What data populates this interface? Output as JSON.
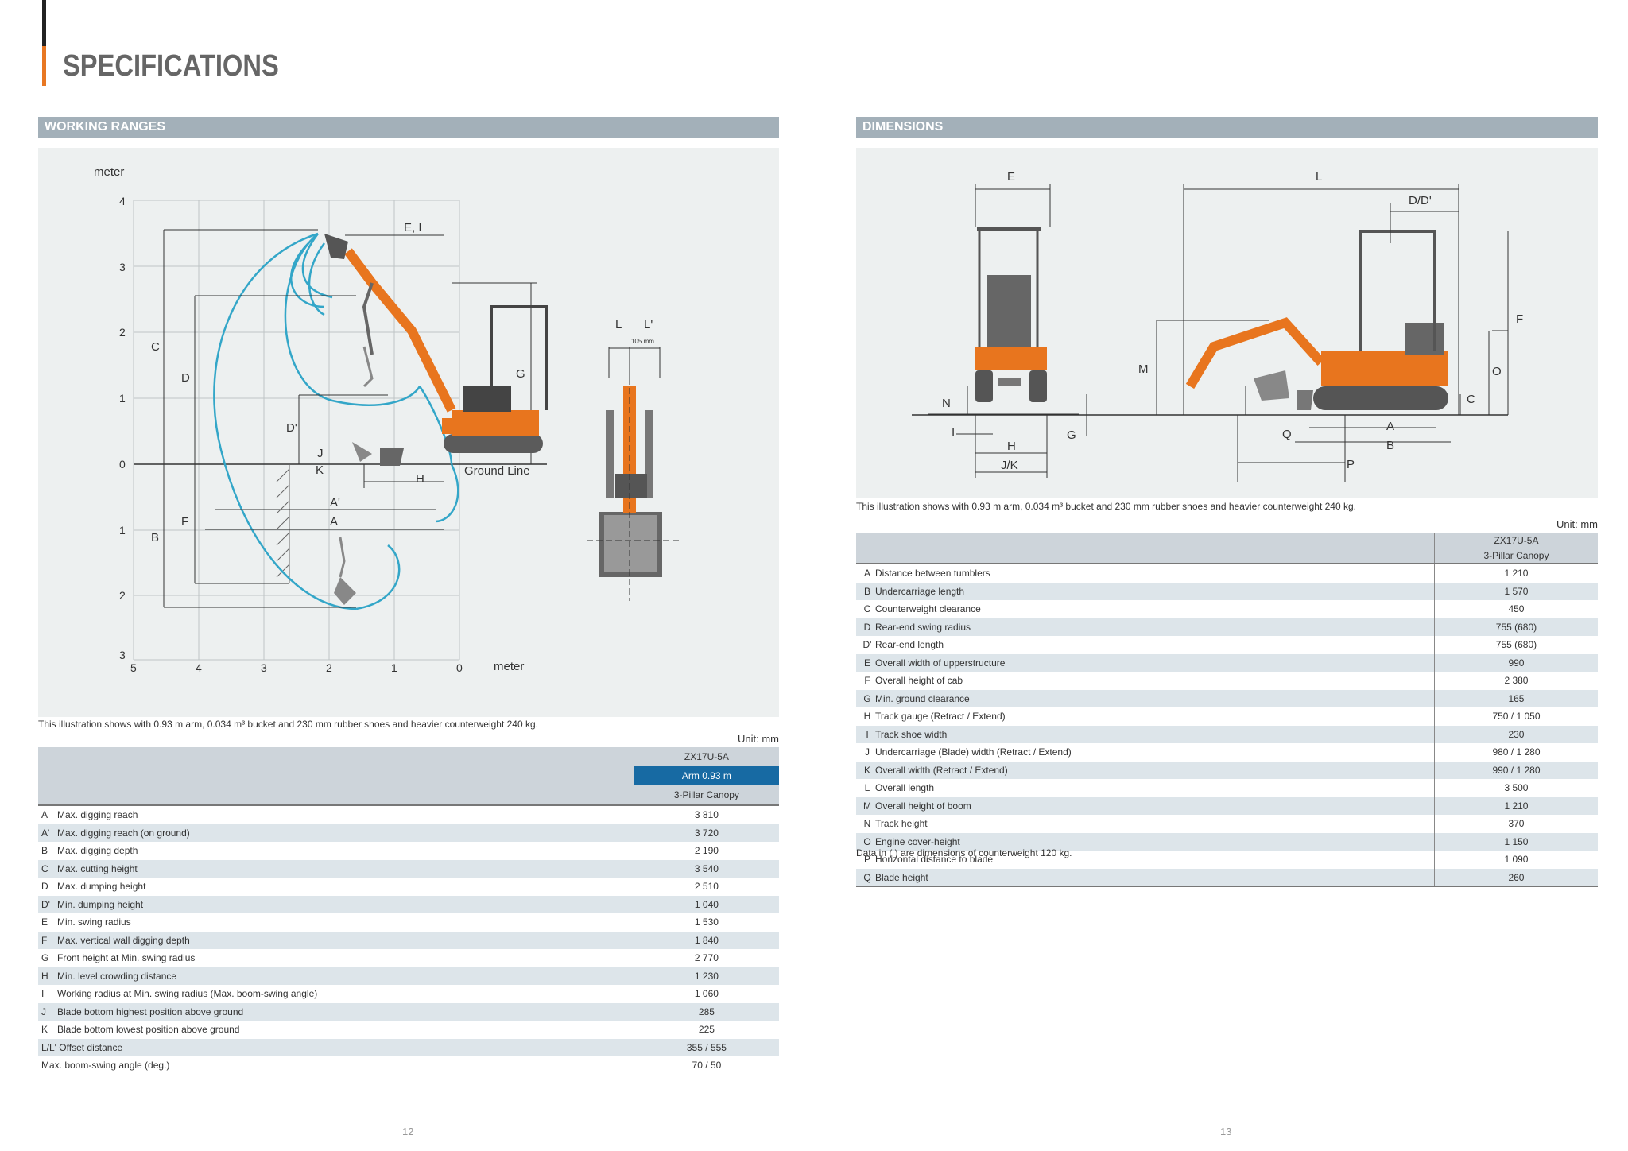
{
  "page_title": "SPECIFICATIONS",
  "left": {
    "section_title": "WORKING RANGES",
    "diagram": {
      "y_unit": "meter",
      "x_unit": "meter",
      "y_ticks_up": [
        "4",
        "3",
        "2",
        "1",
        "0"
      ],
      "y_ticks_down": [
        "1",
        "2",
        "3"
      ],
      "x_ticks": [
        "5",
        "4",
        "3",
        "2",
        "1",
        "0"
      ],
      "labels": [
        "E, I",
        "C",
        "D",
        "G",
        "D'",
        "J",
        "K",
        "H",
        "Ground Line",
        "A'",
        "A",
        "F",
        "B"
      ],
      "offset_labels": [
        "L",
        "L'",
        "105 mm"
      ]
    },
    "note": "This illustration shows with 0.93 m arm, 0.034 m³ bucket and 230 mm rubber shoes and heavier counterweight 240 kg.",
    "unit": "Unit: mm",
    "table": {
      "model": "ZX17U-5A",
      "arm": "Arm 0.93 m",
      "canopy": "3-Pillar Canopy",
      "rows": [
        {
          "letter": "A",
          "label": "Max. digging reach",
          "value": "3 810"
        },
        {
          "letter": "A'",
          "label": "Max. digging reach (on ground)",
          "value": "3 720"
        },
        {
          "letter": "B",
          "label": "Max. digging depth",
          "value": "2 190"
        },
        {
          "letter": "C",
          "label": "Max. cutting height",
          "value": "3 540"
        },
        {
          "letter": "D",
          "label": "Max. dumping height",
          "value": "2 510"
        },
        {
          "letter": "D'",
          "label": "Min. dumping height",
          "value": "1 040"
        },
        {
          "letter": "E",
          "label": "Min. swing radius",
          "value": "1 530"
        },
        {
          "letter": "F",
          "label": "Max. vertical wall digging depth",
          "value": "1 840"
        },
        {
          "letter": "G",
          "label": "Front height at Min. swing radius",
          "value": "2 770"
        },
        {
          "letter": "H",
          "label": "Min. level crowding distance",
          "value": "1 230"
        },
        {
          "letter": "I",
          "label": "Working radius at Min. swing radius (Max. boom-swing angle)",
          "value": "1 060"
        },
        {
          "letter": "J",
          "label": "Blade bottom highest position above ground",
          "value": "285"
        },
        {
          "letter": "K",
          "label": "Blade bottom lowest position above ground",
          "value": "225"
        },
        {
          "letter": "",
          "label": "L/L' Offset distance",
          "value": "355 / 555"
        },
        {
          "letter": "",
          "label": "Max. boom-swing angle (deg.)",
          "value": "70 / 50"
        }
      ]
    },
    "page_number": "12"
  },
  "right": {
    "section_title": "DIMENSIONS",
    "diagram": {
      "labels": [
        "E",
        "N",
        "I",
        "G",
        "H",
        "J/K",
        "L",
        "D/D'",
        "F",
        "M",
        "O",
        "C",
        "Q",
        "A",
        "B",
        "P"
      ]
    },
    "note": "This illustration shows with 0.93 m arm, 0.034 m³ bucket and 230 mm rubber shoes and heavier counterweight 240 kg.",
    "unit": "Unit: mm",
    "table": {
      "model": "ZX17U-5A",
      "canopy": "3-Pillar Canopy",
      "rows": [
        {
          "letter": "A",
          "label": "Distance between tumblers",
          "value": "1 210"
        },
        {
          "letter": "B",
          "label": "Undercarriage length",
          "value": "1 570"
        },
        {
          "letter": "C",
          "label": "Counterweight clearance",
          "value": "450"
        },
        {
          "letter": "D",
          "label": "Rear-end swing radius",
          "value": "755 (680)"
        },
        {
          "letter": "D'",
          "label": "Rear-end length",
          "value": "755 (680)"
        },
        {
          "letter": "E",
          "label": "Overall width of upperstructure",
          "value": "990"
        },
        {
          "letter": "F",
          "label": "Overall height of cab",
          "value": "2 380"
        },
        {
          "letter": "G",
          "label": "Min. ground clearance",
          "value": "165"
        },
        {
          "letter": "H",
          "label": "Track gauge (Retract / Extend)",
          "value": "750 / 1 050"
        },
        {
          "letter": "I",
          "label": "Track shoe width",
          "value": "230"
        },
        {
          "letter": "J",
          "label": "Undercarriage (Blade) width (Retract / Extend)",
          "value": "980 / 1 280"
        },
        {
          "letter": "K",
          "label": "Overall width (Retract / Extend)",
          "value": "990 / 1 280"
        },
        {
          "letter": "L",
          "label": "Overall length",
          "value": "3 500"
        },
        {
          "letter": "M",
          "label": "Overall height of boom",
          "value": "1 210"
        },
        {
          "letter": "N",
          "label": "Track height",
          "value": "370"
        },
        {
          "letter": "O",
          "label": "Engine cover-height",
          "value": "1 150"
        },
        {
          "letter": "P",
          "label": "Horizontal distance to blade",
          "value": "1 090"
        },
        {
          "letter": "Q",
          "label": "Blade height",
          "value": "260"
        }
      ]
    },
    "footnote": "Data in (   ) are dimensions of counterweight 120 kg.",
    "page_number": "13"
  }
}
